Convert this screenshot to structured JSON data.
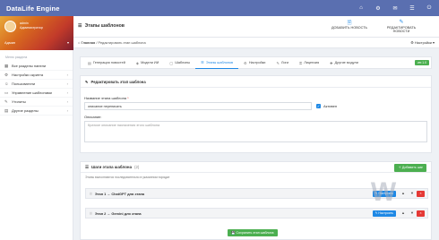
{
  "app": {
    "title": "DataLife Engine"
  },
  "topbar": {
    "icons": [
      "home-icon",
      "sitemap-icon",
      "bell-icon",
      "settings-icon",
      "logout-icon"
    ]
  },
  "user": {
    "name": "admin",
    "status": "Администратор",
    "role": "Админ"
  },
  "sidebar": {
    "heading": "Меню раздела",
    "items": [
      {
        "label": "Все разделы панели",
        "icon": "grid-icon",
        "chevron": ""
      },
      {
        "label": "Настройки скрипта",
        "icon": "gear-icon",
        "chevron": "›"
      },
      {
        "label": "Пользователи",
        "icon": "users-icon",
        "chevron": "›"
      },
      {
        "label": "Управление шаблонами",
        "icon": "monitor-icon",
        "chevron": "›"
      },
      {
        "label": "Утилиты",
        "icon": "wrench-icon",
        "chevron": "›"
      },
      {
        "label": "Другие разделы",
        "icon": "grid2-icon",
        "chevron": "›"
      }
    ]
  },
  "header": {
    "title": "Этапы шаблонов",
    "buttons": [
      {
        "label": "ДОБАВИТЬ НОВОСТЬ",
        "icon": "doc-add-icon"
      },
      {
        "label": "РЕДАКТИРОВАТЬ НОВОСТИ",
        "icon": "doc-edit-icon"
      }
    ]
  },
  "breadcrumb": {
    "home": "Главная",
    "sep": "/",
    "current": "Редактировать этап шаблона",
    "settings": "Настройки"
  },
  "tabs": [
    {
      "label": "Генерация новостей",
      "icon": "doc-icon",
      "active": false
    },
    {
      "label": "Модели ИИ",
      "icon": "cube-icon",
      "active": false
    },
    {
      "label": "Шаблоны",
      "icon": "file-icon",
      "active": false
    },
    {
      "label": "Этапы шаблонов",
      "icon": "steps-icon",
      "active": true
    },
    {
      "label": "Настройки",
      "icon": "gear-icon",
      "active": false
    },
    {
      "label": "Логи",
      "icon": "pencil-icon",
      "active": false
    },
    {
      "label": "Лицензия",
      "icon": "key-icon",
      "active": false
    },
    {
      "label": "Другие модули",
      "icon": "puzzle-icon",
      "active": false
    }
  ],
  "version": "ver.1.0",
  "edit_panel": {
    "title": "Редактировать этап шаблона",
    "name_label": "Название этапа шаблона",
    "required_mark": "*",
    "name_value": "описание переписать",
    "active_label": "Активен",
    "desc_label": "Описание:",
    "desc_placeholder": "Краткое описание назначения этого шаблона"
  },
  "steps_panel": {
    "title": "Шаги этапа шаблона",
    "count": "(2)",
    "add_button": "Добавить шаг",
    "hint": "Этапы выполняются последовательно в указанном порядке",
    "steps": [
      {
        "name": "Этап 1 → ChatGPT для этапа",
        "edit": "Настроить",
        "delete": "×"
      },
      {
        "name": "Этап 2 → Gemini для этапа",
        "edit": "Настроить",
        "delete": "×"
      }
    ],
    "save_button": "Сохранить этап шаблона"
  },
  "colors": {
    "topbar": "#5a6fb0",
    "accent": "#1e88e5",
    "success": "#4caf50",
    "danger": "#e53935"
  }
}
